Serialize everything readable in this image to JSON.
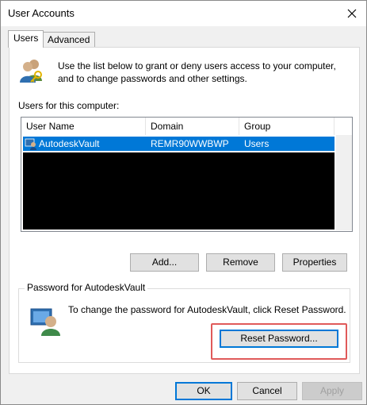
{
  "window": {
    "title": "User Accounts"
  },
  "tabs": [
    {
      "label": "Users",
      "active": true
    },
    {
      "label": "Advanced",
      "active": false
    }
  ],
  "intro": {
    "line1": "Use the list below to grant or deny users access to your computer,",
    "line2": "and to change passwords and other settings."
  },
  "users_label": "Users for this computer:",
  "table": {
    "columns": [
      "User Name",
      "Domain",
      "Group"
    ],
    "rows": [
      {
        "user": "AutodeskVault",
        "domain": "REMR90WWBWP",
        "group": "Users",
        "selected": true
      }
    ]
  },
  "buttons": {
    "add": "Add...",
    "remove": "Remove",
    "properties": "Properties",
    "reset_password": "Reset Password...",
    "ok": "OK",
    "cancel": "Cancel",
    "apply": "Apply"
  },
  "password_group": {
    "title": "Password for AutodeskVault",
    "text": "To change the password for AutodeskVault, click Reset Password."
  },
  "colors": {
    "selection": "#0078d7",
    "highlight_box": "#e05a5a"
  },
  "icons": {
    "users": "users-key-icon",
    "user_row": "user-row-icon",
    "password": "password-user-icon",
    "close": "close-icon"
  }
}
